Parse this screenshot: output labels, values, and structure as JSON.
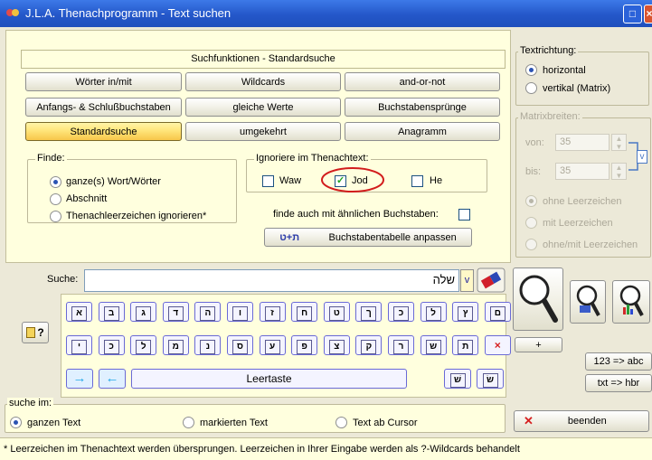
{
  "window": {
    "title": "J.L.A. Thenachprogramm - Text suchen"
  },
  "header": "Suchfunktionen - Standardsuche",
  "tabs": [
    {
      "label": "Wörter in/mit"
    },
    {
      "label": "Wildcards"
    },
    {
      "label": "and-or-not"
    },
    {
      "label": "Anfangs- & Schlußbuchstaben"
    },
    {
      "label": "gleiche Werte"
    },
    {
      "label": "Buchstabensprünge"
    },
    {
      "label": "Standardsuche"
    },
    {
      "label": "umgekehrt"
    },
    {
      "label": "Anagramm"
    }
  ],
  "finde": {
    "label": "Finde:",
    "options": [
      "ganze(s) Wort/Wörter",
      "Abschnitt",
      "Thenachleerzeichen ignorieren*"
    ]
  },
  "ignoriere": {
    "label": "Ignoriere im Thenachtext:",
    "options": [
      "Waw",
      "Jod",
      "He"
    ]
  },
  "aehnlich_label": "finde auch mit ähnlichen Buchstaben:",
  "table_button": "Buchstabentabelle anpassen",
  "table_button_icon": "ת+ט",
  "textrichtung": {
    "label": "Textrichtung:",
    "options": [
      "horizontal",
      "vertikal (Matrix)"
    ]
  },
  "matrix": {
    "label": "Matrixbreiten:",
    "von_label": "von:",
    "von": "35",
    "bis_label": "bis:",
    "bis": "35",
    "options": [
      "ohne Leerzeichen",
      "mit Leerzeichen",
      "ohne/mit Leerzeichen"
    ],
    "v": "v"
  },
  "suche": {
    "label": "Suche:",
    "value": "שלה",
    "v": "v"
  },
  "help": "?",
  "keys_row1": [
    "א",
    "ב",
    "ג",
    "ד",
    "ה",
    "ו",
    "ז",
    "ח",
    "ט",
    "ך",
    "כ",
    "ל",
    "ץ",
    "ם"
  ],
  "keys_row2": [
    "י",
    "כ",
    "ל",
    "מ",
    "נ",
    "ס",
    "ע",
    "פ",
    "צ",
    "ק",
    "ר",
    "ש",
    "ת",
    "×"
  ],
  "arrow_right": "→",
  "arrow_left": "←",
  "space_label": "Leertaste",
  "keys_extra": [
    "שׁ",
    "שׂ"
  ],
  "plus": "+",
  "conv1": "123 => abc",
  "conv2": "txt => hbr",
  "beenden": "beenden",
  "beenden_icon": "✕",
  "suche_im": {
    "label": "suche im:",
    "options": [
      "ganzen Text",
      "markierten Text",
      "Text ab Cursor"
    ]
  },
  "status": "* Leerzeichen im Thenachtext werden übersprungen. Leerzeichen in Ihrer Eingabe werden als ?-Wildcards behandelt"
}
